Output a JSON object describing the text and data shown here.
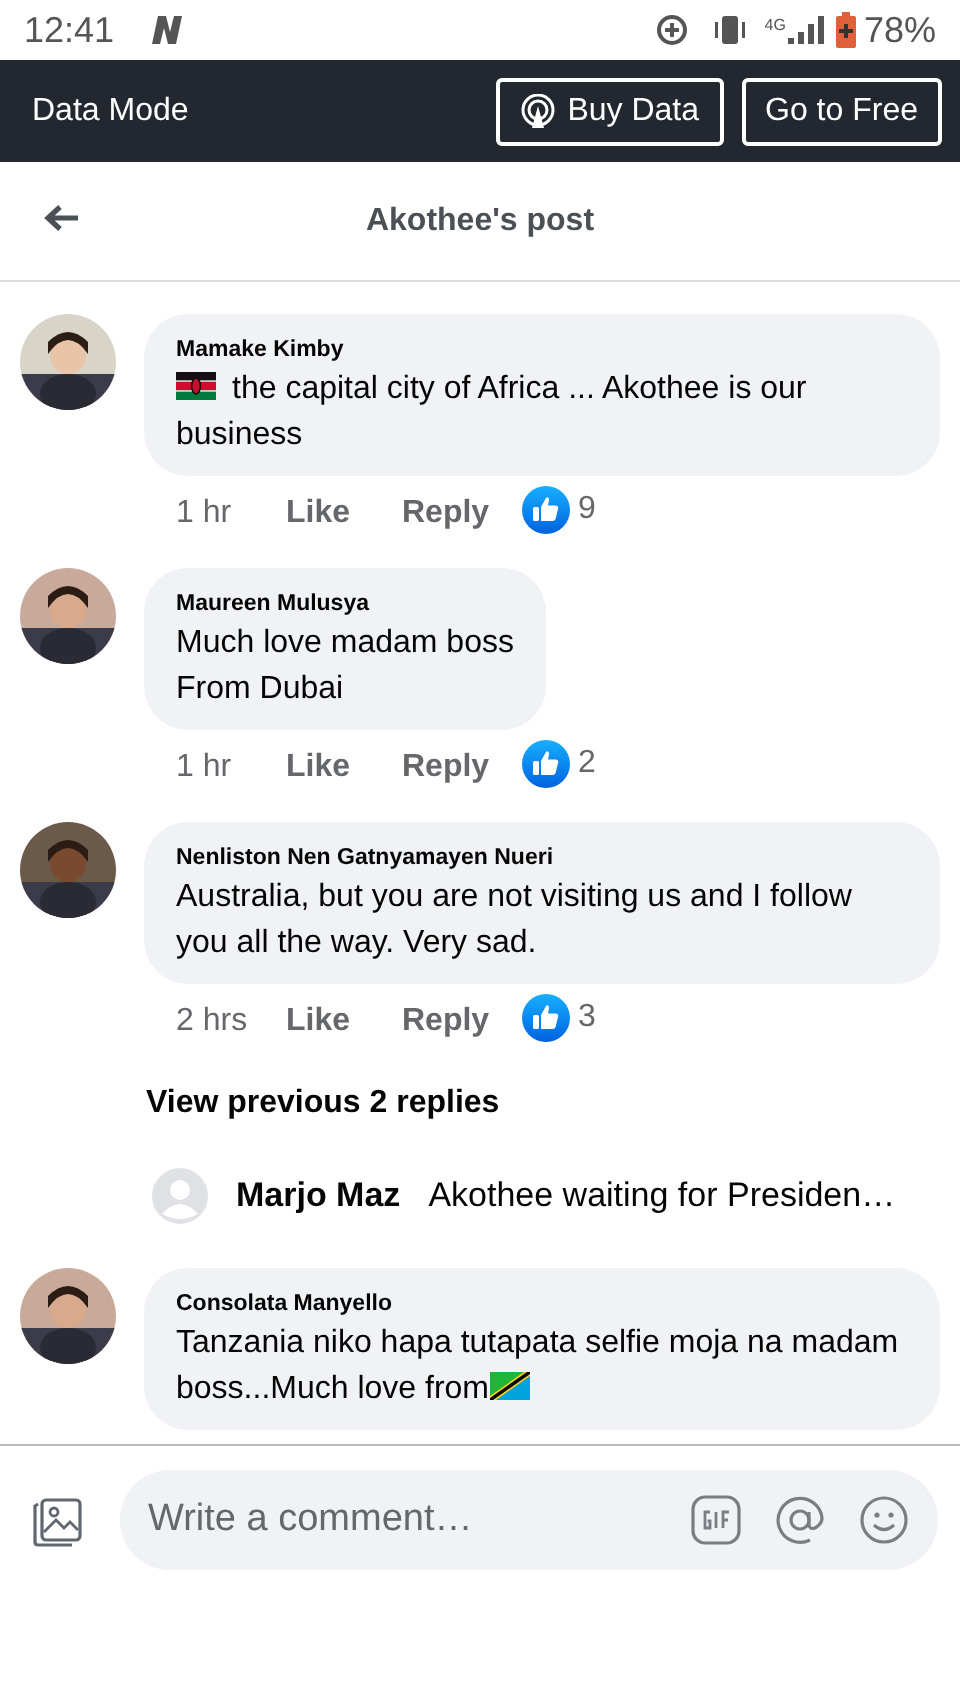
{
  "status_bar": {
    "time": "12:41",
    "network": "4G",
    "battery": "78%"
  },
  "data_mode_bar": {
    "title": "Data Mode",
    "buttons": [
      {
        "kind": "buy",
        "label": "Buy Data"
      },
      {
        "kind": "free",
        "label": "Go to Free"
      }
    ]
  },
  "header": {
    "title": "Akothee's post"
  },
  "comments": [
    {
      "kind": "comment",
      "author": "Mamake Kimby",
      "body": [
        {
          "kind": "kenya_flag"
        },
        {
          "kind": "text",
          "text": "the capital city of Africa ... Akothee is our business"
        }
      ],
      "time": "1 hr",
      "like_label": "Like",
      "reply_label": "Reply",
      "reactions": "9"
    },
    {
      "kind": "comment",
      "author": "Maureen Mulusya",
      "body": [
        {
          "kind": "text",
          "text": "Much love madam boss\nFrom Dubai"
        }
      ],
      "time": "1 hr",
      "like_label": "Like",
      "reply_label": "Reply",
      "reactions": "2"
    },
    {
      "kind": "comment",
      "author": "Nenliston Nen Gatnyamayen Nueri",
      "body": [
        {
          "kind": "text",
          "text": "Australia,  but you are not visiting us and I follow you all the way. Very sad."
        }
      ],
      "time": "2 hrs",
      "like_label": "Like",
      "reply_label": "Reply",
      "reactions": "3"
    },
    {
      "kind": "more_replies",
      "label": "View previous 2 replies"
    },
    {
      "kind": "reply_preview",
      "author": "Marjo Maz",
      "text": "Akothee  waiting  for Presiden…"
    },
    {
      "kind": "comment",
      "author": "Consolata Manyello",
      "body": [
        {
          "kind": "text",
          "text": "Tanzania niko hapa tutapata selfie moja na madam boss...Much love from"
        },
        {
          "kind": "tanzania_flag"
        }
      ]
    }
  ],
  "composer": {
    "placeholder": "Write a comment…"
  }
}
